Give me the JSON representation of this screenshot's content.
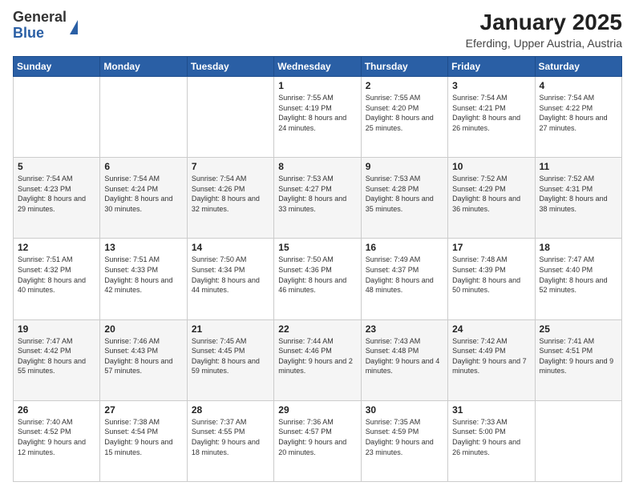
{
  "header": {
    "logo_general": "General",
    "logo_blue": "Blue",
    "title": "January 2025",
    "subtitle": "Eferding, Upper Austria, Austria"
  },
  "calendar": {
    "days_of_week": [
      "Sunday",
      "Monday",
      "Tuesday",
      "Wednesday",
      "Thursday",
      "Friday",
      "Saturday"
    ],
    "weeks": [
      [
        {
          "day": "",
          "info": ""
        },
        {
          "day": "",
          "info": ""
        },
        {
          "day": "",
          "info": ""
        },
        {
          "day": "1",
          "info": "Sunrise: 7:55 AM\nSunset: 4:19 PM\nDaylight: 8 hours\nand 24 minutes."
        },
        {
          "day": "2",
          "info": "Sunrise: 7:55 AM\nSunset: 4:20 PM\nDaylight: 8 hours\nand 25 minutes."
        },
        {
          "day": "3",
          "info": "Sunrise: 7:54 AM\nSunset: 4:21 PM\nDaylight: 8 hours\nand 26 minutes."
        },
        {
          "day": "4",
          "info": "Sunrise: 7:54 AM\nSunset: 4:22 PM\nDaylight: 8 hours\nand 27 minutes."
        }
      ],
      [
        {
          "day": "5",
          "info": "Sunrise: 7:54 AM\nSunset: 4:23 PM\nDaylight: 8 hours\nand 29 minutes."
        },
        {
          "day": "6",
          "info": "Sunrise: 7:54 AM\nSunset: 4:24 PM\nDaylight: 8 hours\nand 30 minutes."
        },
        {
          "day": "7",
          "info": "Sunrise: 7:54 AM\nSunset: 4:26 PM\nDaylight: 8 hours\nand 32 minutes."
        },
        {
          "day": "8",
          "info": "Sunrise: 7:53 AM\nSunset: 4:27 PM\nDaylight: 8 hours\nand 33 minutes."
        },
        {
          "day": "9",
          "info": "Sunrise: 7:53 AM\nSunset: 4:28 PM\nDaylight: 8 hours\nand 35 minutes."
        },
        {
          "day": "10",
          "info": "Sunrise: 7:52 AM\nSunset: 4:29 PM\nDaylight: 8 hours\nand 36 minutes."
        },
        {
          "day": "11",
          "info": "Sunrise: 7:52 AM\nSunset: 4:31 PM\nDaylight: 8 hours\nand 38 minutes."
        }
      ],
      [
        {
          "day": "12",
          "info": "Sunrise: 7:51 AM\nSunset: 4:32 PM\nDaylight: 8 hours\nand 40 minutes."
        },
        {
          "day": "13",
          "info": "Sunrise: 7:51 AM\nSunset: 4:33 PM\nDaylight: 8 hours\nand 42 minutes."
        },
        {
          "day": "14",
          "info": "Sunrise: 7:50 AM\nSunset: 4:34 PM\nDaylight: 8 hours\nand 44 minutes."
        },
        {
          "day": "15",
          "info": "Sunrise: 7:50 AM\nSunset: 4:36 PM\nDaylight: 8 hours\nand 46 minutes."
        },
        {
          "day": "16",
          "info": "Sunrise: 7:49 AM\nSunset: 4:37 PM\nDaylight: 8 hours\nand 48 minutes."
        },
        {
          "day": "17",
          "info": "Sunrise: 7:48 AM\nSunset: 4:39 PM\nDaylight: 8 hours\nand 50 minutes."
        },
        {
          "day": "18",
          "info": "Sunrise: 7:47 AM\nSunset: 4:40 PM\nDaylight: 8 hours\nand 52 minutes."
        }
      ],
      [
        {
          "day": "19",
          "info": "Sunrise: 7:47 AM\nSunset: 4:42 PM\nDaylight: 8 hours\nand 55 minutes."
        },
        {
          "day": "20",
          "info": "Sunrise: 7:46 AM\nSunset: 4:43 PM\nDaylight: 8 hours\nand 57 minutes."
        },
        {
          "day": "21",
          "info": "Sunrise: 7:45 AM\nSunset: 4:45 PM\nDaylight: 8 hours\nand 59 minutes."
        },
        {
          "day": "22",
          "info": "Sunrise: 7:44 AM\nSunset: 4:46 PM\nDaylight: 9 hours\nand 2 minutes."
        },
        {
          "day": "23",
          "info": "Sunrise: 7:43 AM\nSunset: 4:48 PM\nDaylight: 9 hours\nand 4 minutes."
        },
        {
          "day": "24",
          "info": "Sunrise: 7:42 AM\nSunset: 4:49 PM\nDaylight: 9 hours\nand 7 minutes."
        },
        {
          "day": "25",
          "info": "Sunrise: 7:41 AM\nSunset: 4:51 PM\nDaylight: 9 hours\nand 9 minutes."
        }
      ],
      [
        {
          "day": "26",
          "info": "Sunrise: 7:40 AM\nSunset: 4:52 PM\nDaylight: 9 hours\nand 12 minutes."
        },
        {
          "day": "27",
          "info": "Sunrise: 7:38 AM\nSunset: 4:54 PM\nDaylight: 9 hours\nand 15 minutes."
        },
        {
          "day": "28",
          "info": "Sunrise: 7:37 AM\nSunset: 4:55 PM\nDaylight: 9 hours\nand 18 minutes."
        },
        {
          "day": "29",
          "info": "Sunrise: 7:36 AM\nSunset: 4:57 PM\nDaylight: 9 hours\nand 20 minutes."
        },
        {
          "day": "30",
          "info": "Sunrise: 7:35 AM\nSunset: 4:59 PM\nDaylight: 9 hours\nand 23 minutes."
        },
        {
          "day": "31",
          "info": "Sunrise: 7:33 AM\nSunset: 5:00 PM\nDaylight: 9 hours\nand 26 minutes."
        },
        {
          "day": "",
          "info": ""
        }
      ]
    ]
  }
}
